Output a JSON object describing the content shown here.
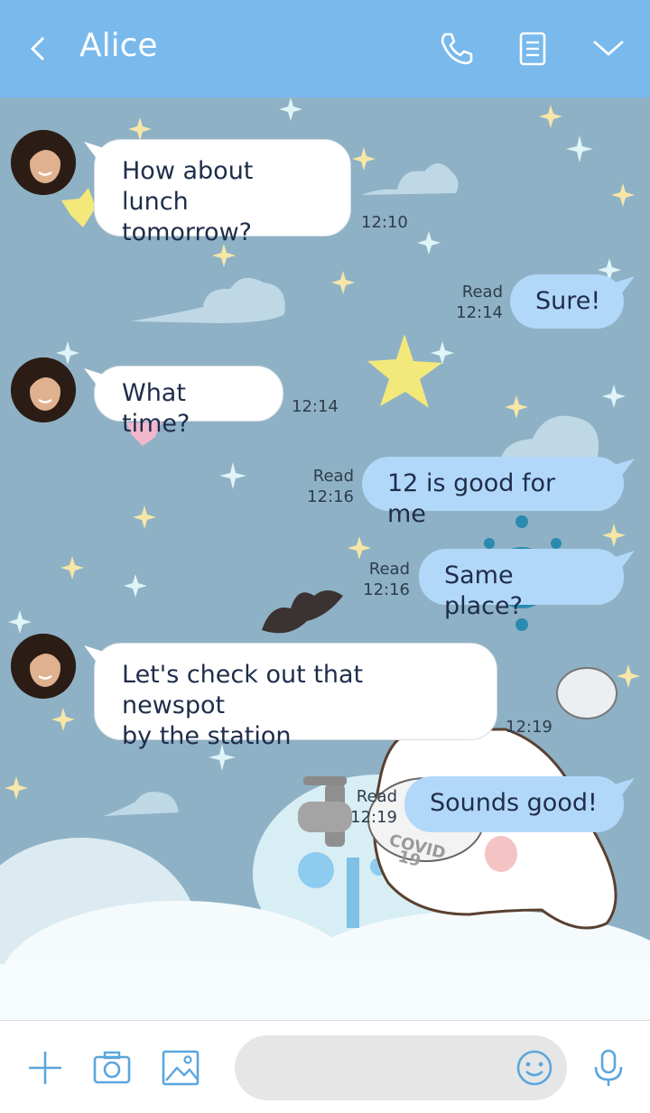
{
  "header": {
    "title": "Alice",
    "back_icon": "chevron-left-icon",
    "call_icon": "phone-icon",
    "notes_icon": "notes-icon",
    "menu_icon": "chevron-down-icon",
    "background": "#79b9ec"
  },
  "messages": [
    {
      "direction": "in",
      "text_lines": [
        "How about lunch",
        "tomorrow?"
      ],
      "time": "12:10"
    },
    {
      "direction": "out",
      "text": "Sure!",
      "read": "Read",
      "time": "12:14"
    },
    {
      "direction": "in",
      "text": "What time?",
      "time": "12:14"
    },
    {
      "direction": "out",
      "text": "12 is good for me",
      "read": "Read",
      "time": "12:16"
    },
    {
      "direction": "out",
      "text": "Same place?",
      "read": "Read",
      "time": "12:16"
    },
    {
      "direction": "in",
      "text_lines": [
        "Let's check out that newspot",
        "by the station"
      ],
      "time": "12:19"
    },
    {
      "direction": "out",
      "text": "Sounds good!",
      "read": "Read",
      "time": "12:19"
    }
  ],
  "footer": {
    "add_icon": "plus-icon",
    "camera_icon": "camera-icon",
    "image_icon": "image-icon",
    "emoji_icon": "smiley-icon",
    "mic_icon": "microphone-icon",
    "accent": "#5aa6de"
  },
  "wallpaper": {
    "background": "#8eb1c5",
    "overlay_text": [
      "COVID",
      "19"
    ]
  }
}
